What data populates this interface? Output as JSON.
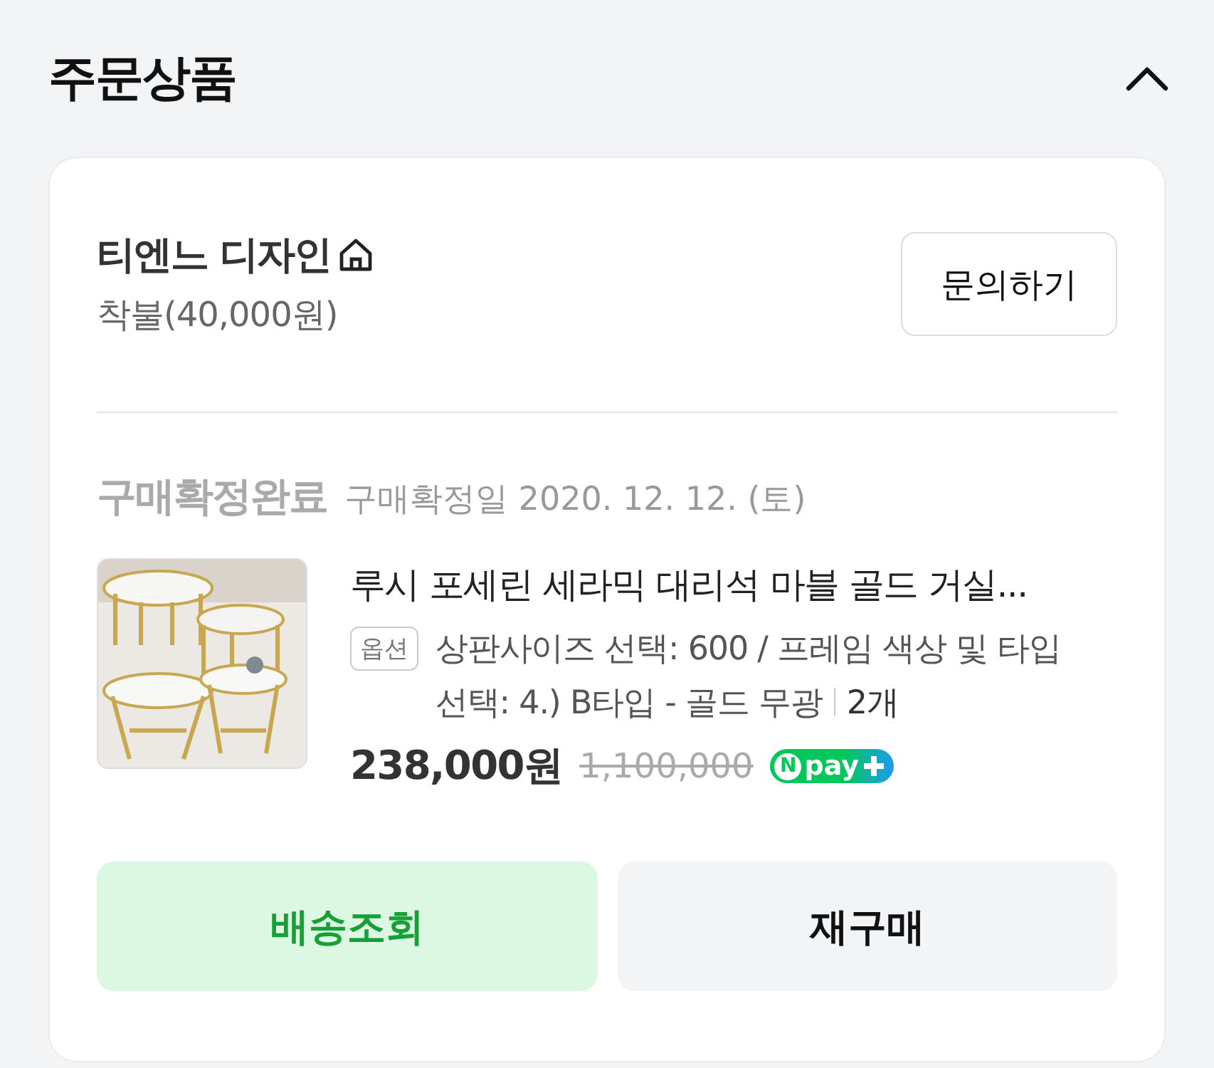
{
  "section": {
    "title": "주문상품",
    "expanded": true
  },
  "seller": {
    "name": "티엔느 디자인",
    "shipping": "착불(40,000원)",
    "contact_button": "문의하기"
  },
  "order": {
    "status": "구매확정완료",
    "confirmed_date": "구매확정일 2020. 12. 12. (토)"
  },
  "product": {
    "title": "루시 포세린 세라믹 대리석 마블 골드 거실...",
    "option_tag": "옵션",
    "option": "상판사이즈 선택: 600 / 프레임 색상 및 타입 선택: 4.) B타입 - 골드 무광",
    "quantity": "2개",
    "price": "238,000원",
    "original_price": "1,100,000",
    "npay": {
      "mark": "N",
      "label": "pay"
    }
  },
  "actions": [
    {
      "label": "배송조회",
      "kind": "primary"
    },
    {
      "label": "재구매",
      "kind": "secondary"
    }
  ]
}
